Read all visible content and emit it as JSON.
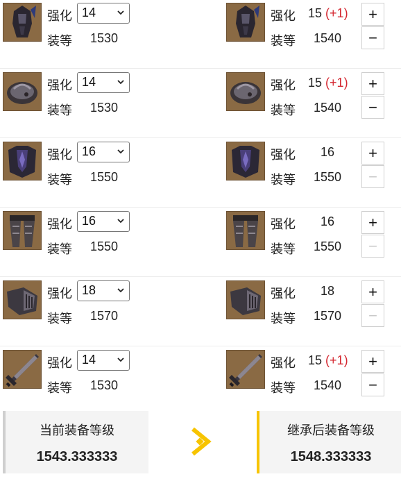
{
  "labels": {
    "enhance": "强化",
    "item_level": "装等"
  },
  "rows": [
    {
      "slot": "helmet",
      "icon": "helmet-icon",
      "current_enhance": "14",
      "current_level": "1530",
      "new_enhance": "15",
      "new_enhance_delta": "(+1)",
      "new_level": "1540",
      "plus": "+",
      "minus": "−",
      "minus_enabled": true
    },
    {
      "slot": "shoulder",
      "icon": "shoulder-armor-icon",
      "current_enhance": "14",
      "current_level": "1530",
      "new_enhance": "15",
      "new_enhance_delta": "(+1)",
      "new_level": "1540",
      "plus": "+",
      "minus": "−",
      "minus_enabled": true
    },
    {
      "slot": "chest",
      "icon": "chest-armor-icon",
      "current_enhance": "16",
      "current_level": "1550",
      "new_enhance": "16",
      "new_enhance_delta": "",
      "new_level": "1550",
      "plus": "+",
      "minus": "−",
      "minus_enabled": false
    },
    {
      "slot": "pants",
      "icon": "leg-armor-icon",
      "current_enhance": "16",
      "current_level": "1550",
      "new_enhance": "16",
      "new_enhance_delta": "",
      "new_level": "1550",
      "plus": "+",
      "minus": "−",
      "minus_enabled": false
    },
    {
      "slot": "gloves",
      "icon": "gauntlet-icon",
      "current_enhance": "18",
      "current_level": "1570",
      "new_enhance": "18",
      "new_enhance_delta": "",
      "new_level": "1570",
      "plus": "+",
      "minus": "−",
      "minus_enabled": false
    },
    {
      "slot": "weapon",
      "icon": "sword-icon",
      "current_enhance": "14",
      "current_level": "1530",
      "new_enhance": "15",
      "new_enhance_delta": "(+1)",
      "new_level": "1540",
      "plus": "+",
      "minus": "−",
      "minus_enabled": true
    }
  ],
  "summary": {
    "current_title": "当前装备等级",
    "current_value": "1543.333333",
    "after_title": "继承后装备等级",
    "after_value": "1548.333333"
  },
  "colors": {
    "accent": "#f7c400",
    "delta": "#d4262f",
    "thumb_bg": "#8a6a44"
  }
}
